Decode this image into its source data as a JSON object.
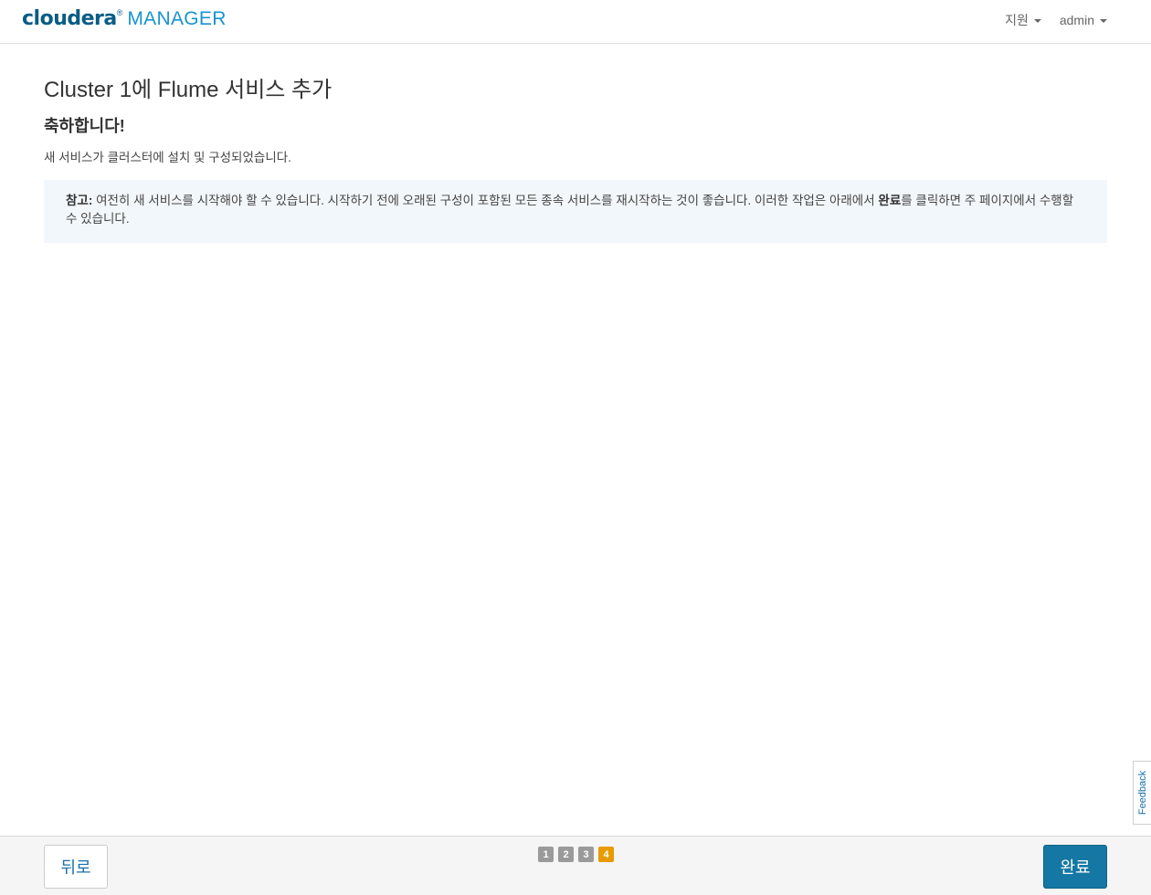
{
  "header": {
    "logo_brand": "cloudera",
    "logo_dot": "®",
    "logo_product": "MANAGER",
    "nav": [
      {
        "label": "지원"
      },
      {
        "label": "admin"
      }
    ]
  },
  "main": {
    "title": "Cluster 1에 Flume 서비스 추가",
    "congrats": "축하합니다!",
    "description": "새 서비스가 클러스터에 설치 및 구성되었습니다.",
    "note": {
      "label": "참고:",
      "text_before": " 여전히 새 서비스를 시작해야 할 수 있습니다. 시작하기 전에 오래된 구성이 포함된 모든 종속 서비스를 재시작하는 것이 좋습니다. 이러한 작업은 아래에서 ",
      "bold": "완료",
      "text_after": "를 클릭하면 주 페이지에서 수행할 수 있습니다."
    }
  },
  "feedback": {
    "label": "Feedback"
  },
  "footer": {
    "back_label": "뒤로",
    "finish_label": "완료",
    "steps": [
      "1",
      "2",
      "3",
      "4"
    ],
    "active_step": "4"
  },
  "colors": {
    "brand_dark": "#0a5c86",
    "brand_light": "#1794cf",
    "primary_button": "#1577a3",
    "active_step": "#e89a00",
    "inactive_step": "#9a9a9a",
    "note_background": "#f2f7fb"
  }
}
